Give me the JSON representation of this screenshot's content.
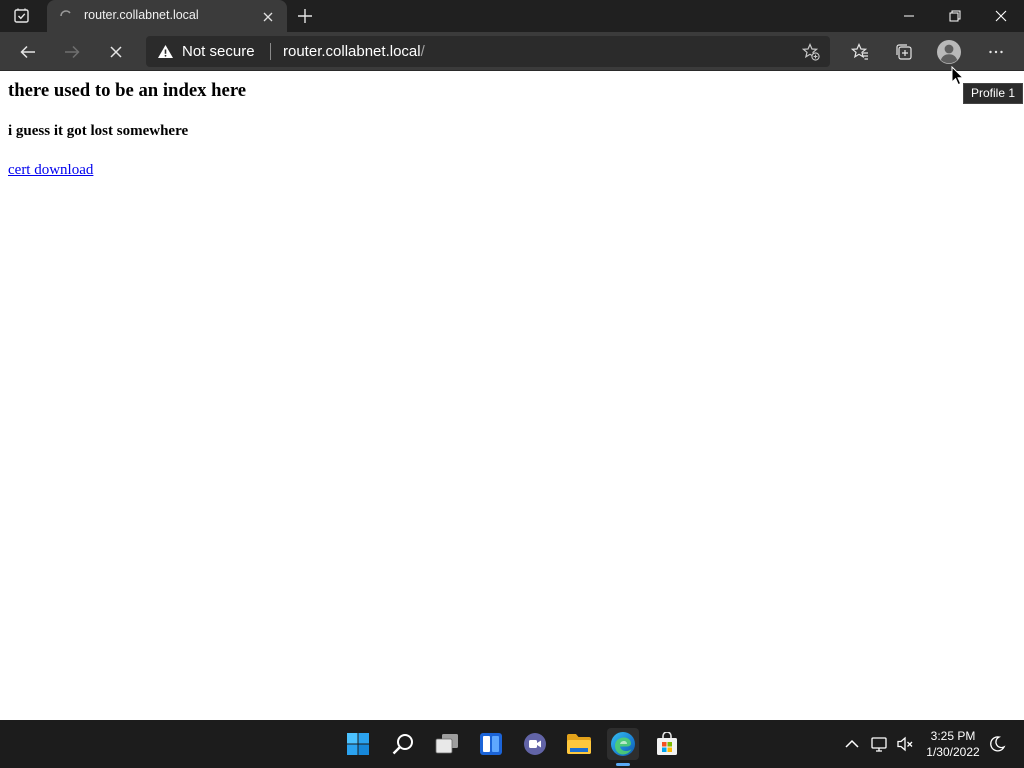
{
  "browser": {
    "tab": {
      "title": "router.collabnet.local"
    },
    "address": {
      "security_label": "Not secure",
      "url_host": "router.collabnet.local",
      "url_path": "/"
    },
    "tooltip": "Profile 1"
  },
  "page": {
    "heading": "there used to be an index here",
    "subheading": "i guess it got lost somewhere",
    "link_text": "cert download"
  },
  "taskbar": {
    "time": "3:25 PM",
    "date": "1/30/2022",
    "apps": [
      "start",
      "search",
      "task-view",
      "widgets",
      "teams-chat",
      "file-explorer",
      "edge",
      "microsoft-store"
    ]
  },
  "colors": {
    "link": "#0000ee",
    "edge_indicator": "#5aaaf5"
  }
}
